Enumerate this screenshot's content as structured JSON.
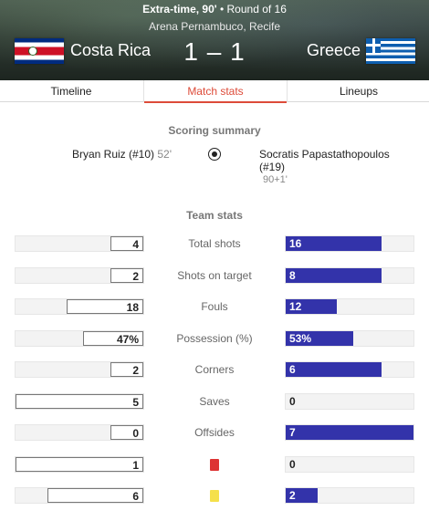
{
  "match": {
    "status": "Extra-time, 90'",
    "separator": " • ",
    "round": "Round of 16",
    "venue": "Arena Pernambuco, Recife",
    "home_team": "Costa Rica",
    "away_team": "Greece",
    "score": "1 – 1"
  },
  "tabs": [
    "Timeline",
    "Match stats",
    "Lineups"
  ],
  "active_tab": "Match stats",
  "scoring_summary": {
    "title": "Scoring summary",
    "home_scorer": "Bryan Ruiz (#10)",
    "home_minute": "52'",
    "away_scorer": "Socratis Papastathopoulos (#19)",
    "away_minute": "90+1'"
  },
  "team_stats": {
    "title": "Team stats",
    "rows": [
      {
        "label": "Total shots",
        "home": "4",
        "away": "16",
        "home_frac": 0.25,
        "away_frac": 0.75
      },
      {
        "label": "Shots on target",
        "home": "2",
        "away": "8",
        "home_frac": 0.25,
        "away_frac": 0.75
      },
      {
        "label": "Fouls",
        "home": "18",
        "away": "12",
        "home_frac": 0.6,
        "away_frac": 0.4
      },
      {
        "label": "Possession (%)",
        "home": "47%",
        "away": "53%",
        "home_frac": 0.47,
        "away_frac": 0.53
      },
      {
        "label": "Corners",
        "home": "2",
        "away": "6",
        "home_frac": 0.25,
        "away_frac": 0.75
      },
      {
        "label": "Saves",
        "home": "5",
        "away": "0",
        "home_frac": 1.0,
        "away_frac": 0.0
      },
      {
        "label": "Offsides",
        "home": "0",
        "away": "7",
        "home_frac": 0.0,
        "away_frac": 1.0
      },
      {
        "label": "",
        "icon": "red-card-icon",
        "icon_color": "#dd3333",
        "home": "1",
        "away": "0",
        "home_frac": 1.0,
        "away_frac": 0.0
      },
      {
        "label": "",
        "icon": "yellow-card-icon",
        "icon_color": "#f5e04a",
        "home": "6",
        "away": "2",
        "home_frac": 0.75,
        "away_frac": 0.25
      }
    ]
  },
  "colors": {
    "accent": "#dd4b39",
    "away_bar": "#3333aa",
    "home_bar": "#ffffff"
  }
}
